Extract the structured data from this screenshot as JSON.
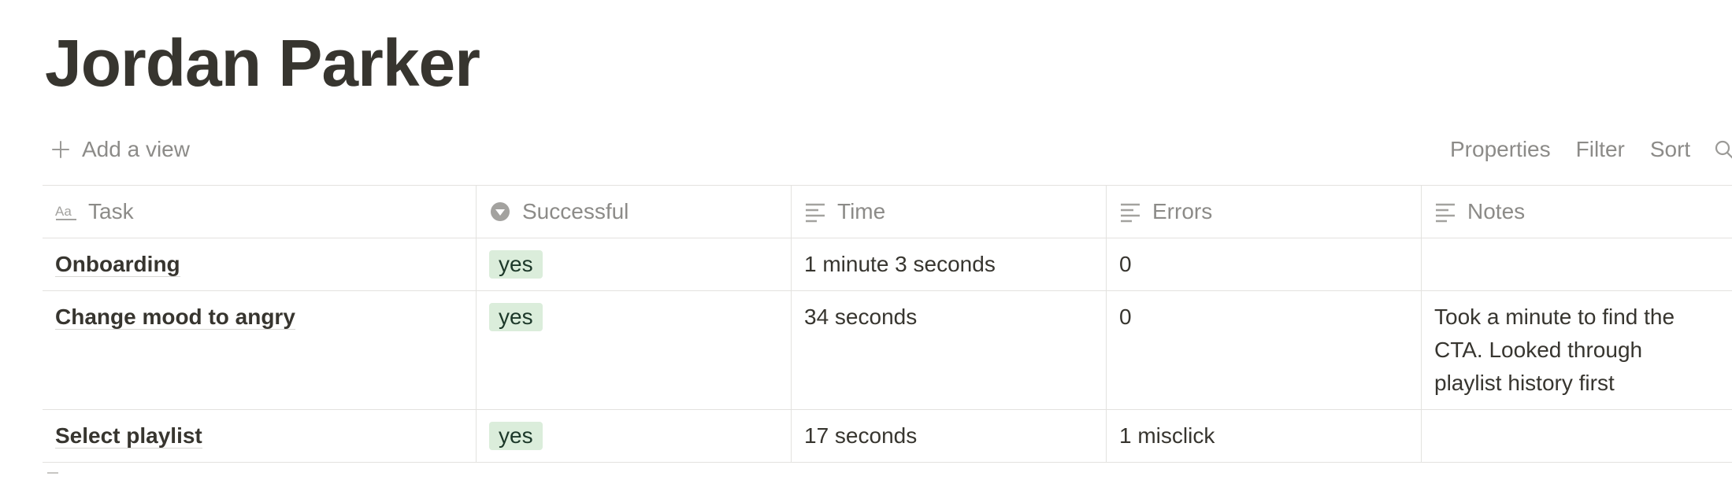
{
  "page": {
    "title": "Jordan Parker"
  },
  "view_bar": {
    "add_view_label": "Add a view",
    "properties_label": "Properties",
    "filter_label": "Filter",
    "sort_label": "Sort"
  },
  "table": {
    "columns": [
      {
        "label": "Task",
        "icon": "text-aa-icon"
      },
      {
        "label": "Successful",
        "icon": "select-dropdown-icon"
      },
      {
        "label": "Time",
        "icon": "lines-icon"
      },
      {
        "label": "Errors",
        "icon": "lines-icon"
      },
      {
        "label": "Notes",
        "icon": "lines-icon"
      }
    ],
    "rows": [
      {
        "task": "Onboarding",
        "successful": "yes",
        "time": "1 minute 3 seconds",
        "errors": "0",
        "notes": ""
      },
      {
        "task": "Change mood to angry",
        "successful": "yes",
        "time": "34 seconds",
        "errors": "0",
        "notes": "Took a minute to find the CTA. Looked through playlist history first"
      },
      {
        "task": "Select playlist",
        "successful": "yes",
        "time": "17 seconds",
        "errors": "1 misclick",
        "notes": ""
      }
    ]
  },
  "colors": {
    "tag_green_bg": "#dbeddb",
    "text": "#37352f",
    "muted": "#8c8b88",
    "border": "#e3e2df"
  }
}
